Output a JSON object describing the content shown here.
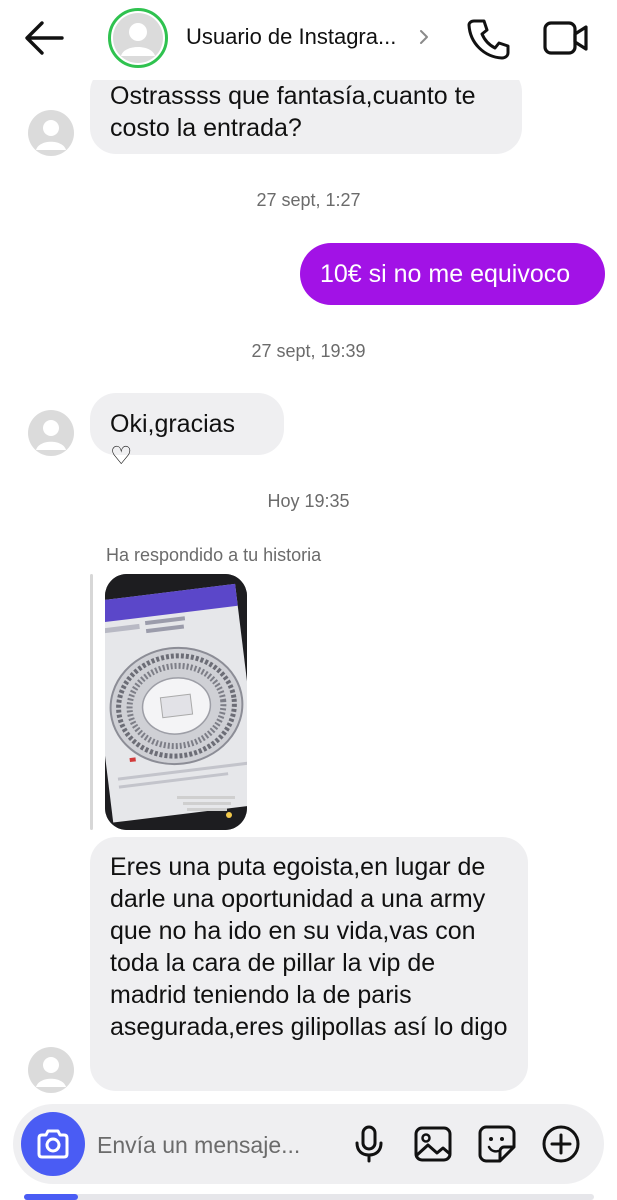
{
  "header": {
    "username": "Usuario de Instagra...",
    "back_icon": "arrow-left-icon",
    "call_icon": "phone-icon",
    "video_icon": "video-camera-icon"
  },
  "messages": [
    {
      "type": "incoming",
      "text": "Ostrassss que fantasía,cuanto te costo la entrada?"
    },
    {
      "type": "timestamp",
      "text": "27 sept, 1:27"
    },
    {
      "type": "outgoing",
      "text": "10€ si no me equivoco"
    },
    {
      "type": "timestamp",
      "text": "27 sept, 19:39"
    },
    {
      "type": "incoming",
      "text": "Oki,gracias ♡"
    },
    {
      "type": "timestamp",
      "text": "Hoy 19:35"
    },
    {
      "type": "story_reply",
      "label": "Ha respondido a tu historia"
    },
    {
      "type": "incoming",
      "text": "Eres una puta egoista,en lugar de darle una oportunidad a una army que no ha ido en su vida,vas con toda la cara de pillar la vip de madrid teniendo la de paris asegurada,eres gilipollas así lo digo"
    }
  ],
  "composer": {
    "placeholder": "Envía un mensaje...",
    "icons": [
      "camera-icon",
      "microphone-icon",
      "gallery-icon",
      "sticker-icon",
      "plus-icon"
    ]
  },
  "colors": {
    "outgoing_bubble": "#a212e6",
    "incoming_bubble": "#efeff1",
    "camera_button": "#4a5cf4",
    "story_ring": "#2fc24f"
  }
}
